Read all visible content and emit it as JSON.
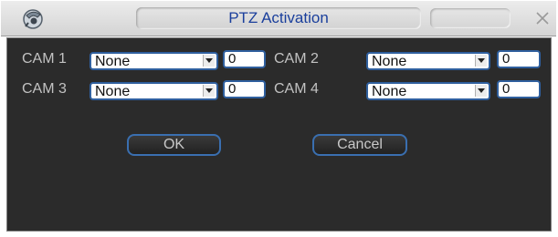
{
  "window": {
    "title": "PTZ Activation"
  },
  "icons": {
    "app": "camera-logo-icon",
    "close": "close-icon",
    "dropdown": "chevron-down-icon"
  },
  "cameras": [
    {
      "label": "CAM 1",
      "mode": "None",
      "value": "0"
    },
    {
      "label": "CAM 2",
      "mode": "None",
      "value": "0"
    },
    {
      "label": "CAM 3",
      "mode": "None",
      "value": "0"
    },
    {
      "label": "CAM 4",
      "mode": "None",
      "value": "0"
    }
  ],
  "buttons": {
    "ok": "OK",
    "cancel": "Cancel"
  },
  "colors": {
    "panel_background": "#2b2b2b",
    "field_border": "#2f5f9e",
    "title_text": "#1a3f9c",
    "label_text": "#c2c2c2"
  }
}
